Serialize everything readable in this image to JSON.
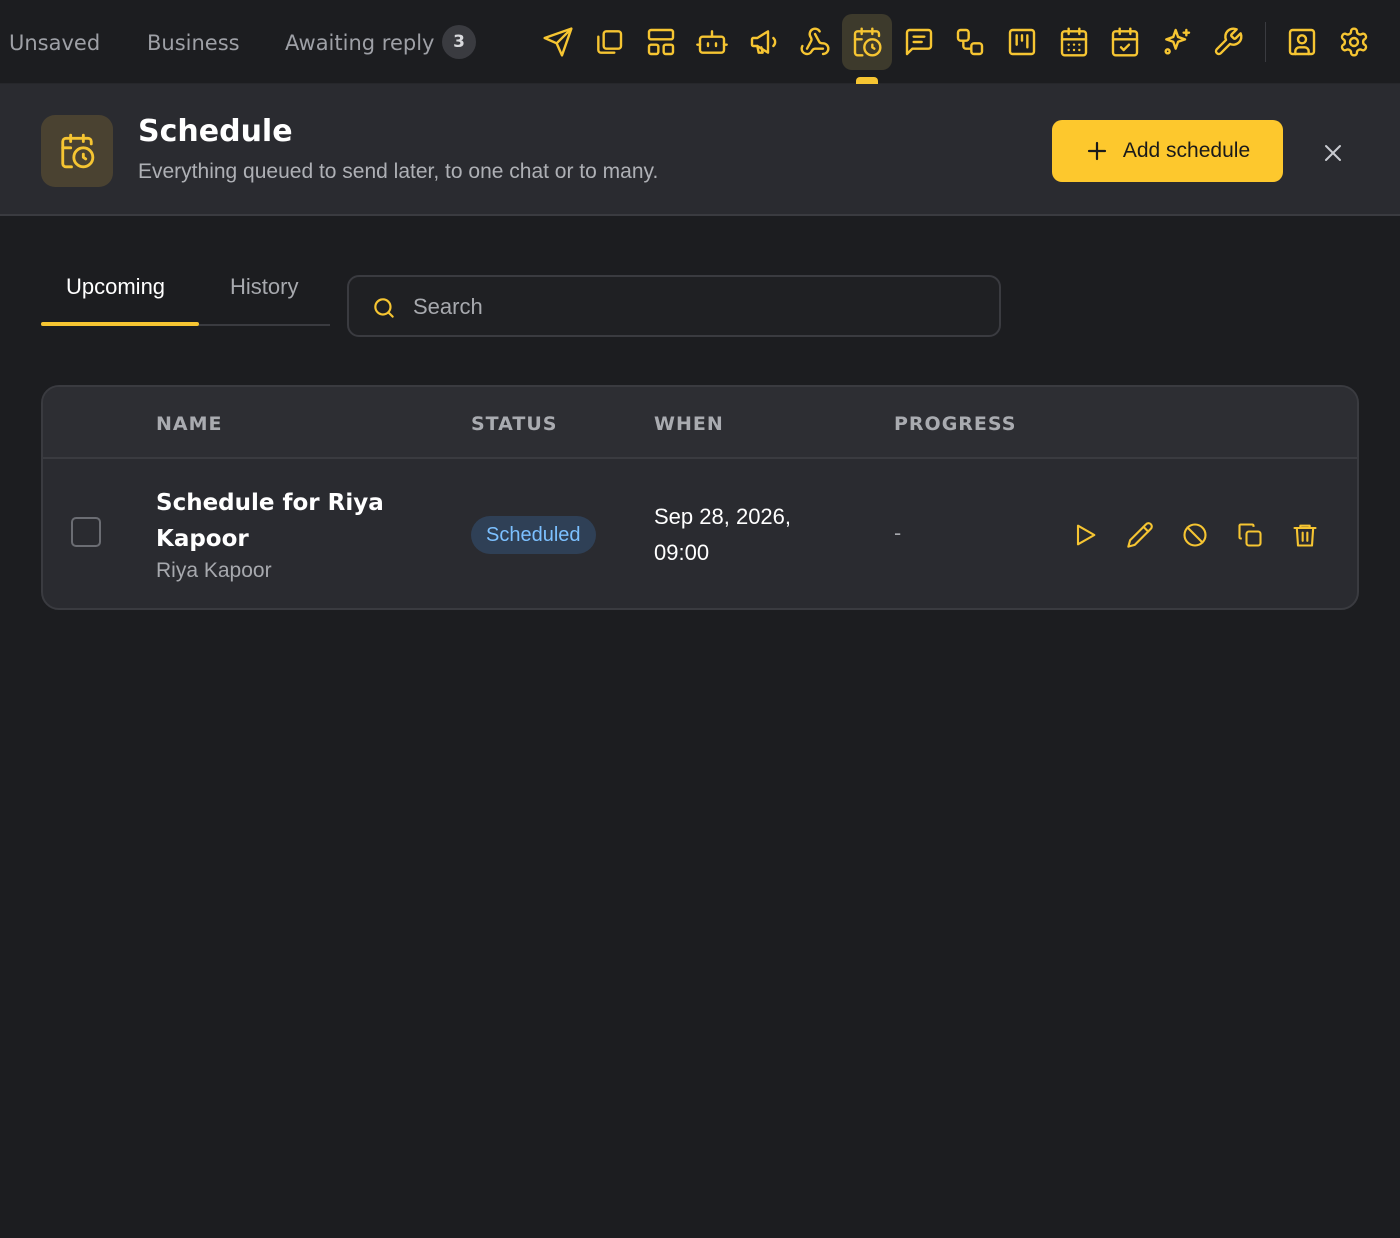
{
  "topbar": {
    "tabs": [
      "Unsaved",
      "Business",
      "Awaiting reply"
    ],
    "awaiting_count": "3",
    "icons": [
      "send-icon",
      "copy-icon",
      "layout-icon",
      "bot-icon",
      "megaphone-icon",
      "webhook-icon",
      "calendar-clock-icon",
      "message-square-icon",
      "workflow-icon",
      "kanban-icon",
      "calendar-grid-icon",
      "calendar-check-icon",
      "sparkles-icon",
      "wrench-icon",
      "contact-icon",
      "settings-icon"
    ],
    "active_icon": "calendar-clock-icon"
  },
  "header": {
    "title": "Schedule",
    "subtitle": "Everything queued to send later, to one chat or to many.",
    "add_label": "Add schedule"
  },
  "tabs": {
    "upcoming": "Upcoming",
    "history": "History",
    "active": "upcoming"
  },
  "search": {
    "placeholder": "Search",
    "value": ""
  },
  "table": {
    "columns": [
      "NAME",
      "STATUS",
      "WHEN",
      "PROGRESS"
    ],
    "rows": [
      {
        "name": "Schedule for Riya Kapoor",
        "recipient": "Riya Kapoor",
        "status": "Scheduled",
        "when": "Sep 28, 2026, 09:00",
        "progress": "-",
        "actions": [
          "play-icon",
          "pencil-icon",
          "ban-icon",
          "duplicate-icon",
          "trash-icon"
        ]
      }
    ]
  },
  "colors": {
    "accent": "#fdc82d",
    "background": "#1c1d20",
    "panel": "#2a2b30",
    "status_blue": "#7cc0ff"
  }
}
